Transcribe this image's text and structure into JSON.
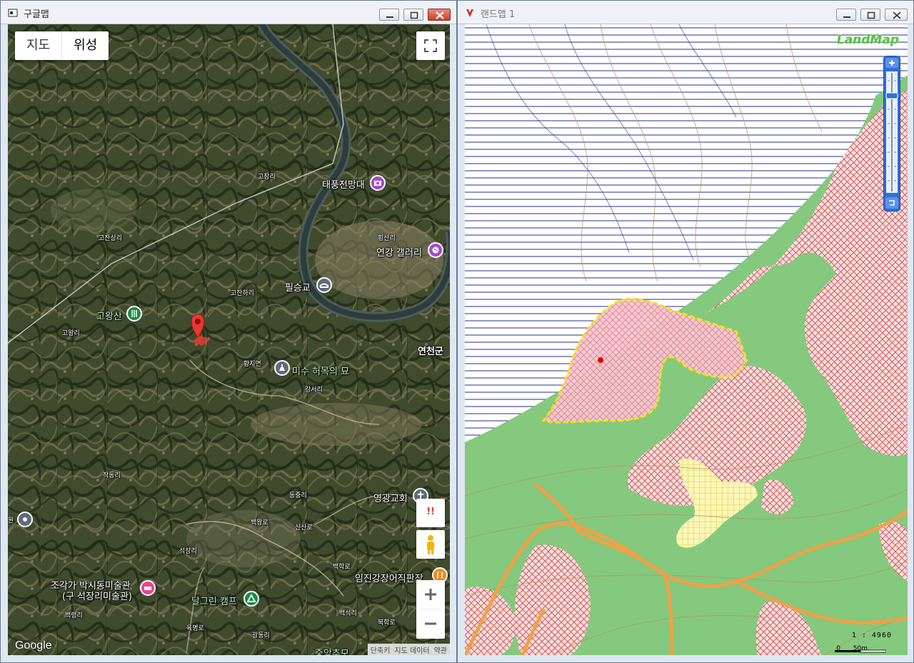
{
  "left_window": {
    "title": "구글맵",
    "map_type": {
      "map": "지도",
      "satellite": "위성",
      "active": "satellite"
    },
    "labels": {
      "go_jang_ri": "고장리",
      "taepung": "태풍전망대",
      "hoengsan_ri": "횡산리",
      "yeongang": "연강 갤러리",
      "gojan_sang_ri": "고잔상리",
      "pilseung": "필승교",
      "gojan_ha_ri": "고잔하리",
      "gowangsan": "고왕산",
      "go_wang_ri": "고왕리",
      "yeoncheon": "연천군",
      "hwangji": "황지면",
      "misu": "미수 허목의 묘",
      "gangseo_ri": "강서리",
      "jakdong_ri": "작동리",
      "dongjung_ri": "동중리",
      "yeonggwang": "영광교회",
      "baegwang": "백왕로",
      "sinsanro": "신산로",
      "seokjang_ri": "석장리",
      "baekhak_ro": "백학로",
      "imjingang": "임진강장어직판장",
      "sculptor": "조각가 박시동미술관",
      "sculptor_sub": "(구 석장리미술관)",
      "dalgrin": "달그린 캠프",
      "baekryeong_ri": "백령리",
      "baekseok_ri": "백석리",
      "yukmyeong": "육명로",
      "bukhak": "북학로",
      "gwangdong_ri": "광동리",
      "jungang": "중앙추모",
      "left_edge": "원"
    },
    "google_logo": "Google",
    "attribution": {
      "shortcut": "단축키",
      "data": "지도 데이터",
      "terms": "약관"
    },
    "warn_label": "!!"
  },
  "right_window": {
    "title": "랜드맵 1",
    "logo": "LandMap",
    "scale_ratio": "1 : 4960",
    "scale_zero": "0",
    "scale_length": "50m"
  },
  "colors": {
    "satellite": "#3e4b2b",
    "forest": "#84c97e",
    "hatch_red": "#c84646",
    "parcel_yellow": "#f4e40a",
    "blue_lines": "#2a2f8c"
  }
}
